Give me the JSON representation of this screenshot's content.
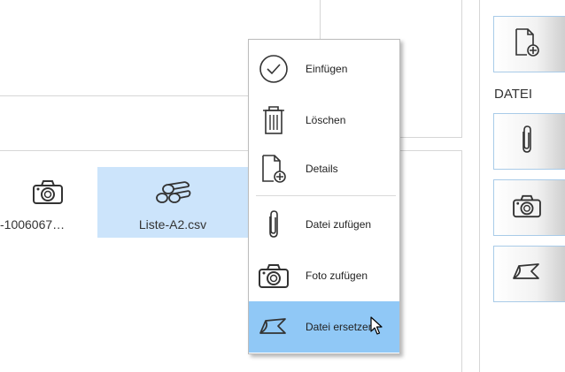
{
  "files": [
    {
      "name": "-1006067…",
      "icon": "camera-icon",
      "selected": false
    },
    {
      "name": "Liste-A2.csv",
      "icon": "logs-icon",
      "selected": true
    }
  ],
  "context_menu": {
    "items": [
      {
        "label": "Einfügen",
        "icon": "checkmark-circle-icon"
      },
      {
        "label": "Löschen",
        "icon": "trash-icon"
      },
      {
        "label": "Details",
        "icon": "new-document-icon"
      },
      {
        "label": "Datei zufügen",
        "icon": "paperclip-icon"
      },
      {
        "label": "Foto zufügen",
        "icon": "camera-icon"
      },
      {
        "label": "Datei ersetzen",
        "icon": "replace-arrow-icon",
        "highlighted": true
      }
    ]
  },
  "side_panel": {
    "heading": "DATEI",
    "buttons": [
      "new-document-icon",
      "paperclip-icon",
      "camera-icon",
      "replace-arrow-icon"
    ]
  },
  "colors": {
    "selection": "#cce4fb",
    "menu_highlight": "#90c8f6",
    "side_button_border": "#a9cbe8"
  }
}
